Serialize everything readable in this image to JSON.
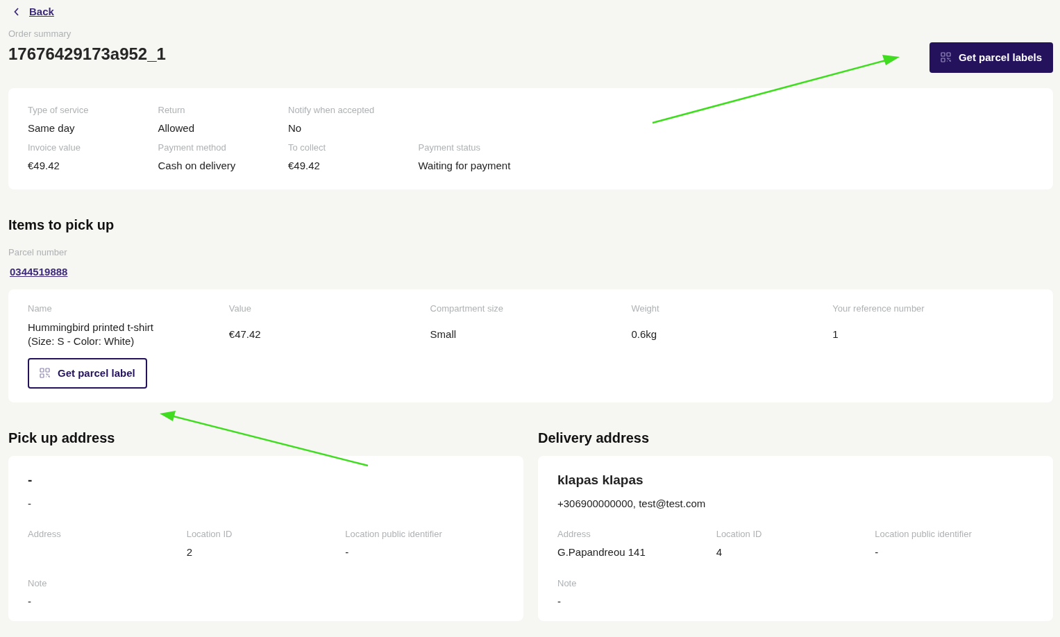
{
  "back": {
    "label": "Back"
  },
  "header": {
    "eyebrow": "Order summary",
    "order_id": "17676429173a952_1",
    "button": "Get parcel labels"
  },
  "summary": [
    [
      {
        "label": "Type of service",
        "value": "Same day"
      },
      {
        "label": "Return",
        "value": "Allowed"
      },
      {
        "label": "Notify when accepted",
        "value": "No"
      }
    ],
    [
      {
        "label": "Invoice value",
        "value": "€49.42"
      },
      {
        "label": "Payment method",
        "value": "Cash on delivery"
      },
      {
        "label": "To collect",
        "value": "€49.42"
      },
      {
        "label": "Payment status",
        "value": "Waiting for payment"
      }
    ]
  ],
  "items": {
    "title": "Items to pick up",
    "parcel_label": "Parcel number",
    "parcel_number": "0344519888",
    "columns": [
      {
        "label": "Name",
        "value": "Hummingbird printed t-shirt\n(Size: S - Color: White)"
      },
      {
        "label": "Value",
        "value": "€47.42"
      },
      {
        "label": "Compartment size",
        "value": "Small"
      },
      {
        "label": "Weight",
        "value": "0.6kg"
      },
      {
        "label": "Your reference number",
        "value": "1"
      }
    ],
    "button": "Get parcel label"
  },
  "addresses": [
    {
      "title": "Pick up address",
      "name": "-",
      "contact": "-",
      "fields": [
        {
          "label": "Address"
        },
        {
          "label": "Location ID",
          "value": "2"
        },
        {
          "label": "Location public identifier",
          "value": "-"
        }
      ],
      "note_label": "Note",
      "note": "-"
    },
    {
      "title": "Delivery address",
      "name": "klapas klapas",
      "contact": "+306900000000, test@test.com",
      "fields": [
        {
          "label": "Address",
          "value": "G.Papandreou 141"
        },
        {
          "label": "Location ID",
          "value": "4"
        },
        {
          "label": "Location public identifier",
          "value": "-"
        }
      ],
      "note_label": "Note",
      "note": "-"
    }
  ]
}
